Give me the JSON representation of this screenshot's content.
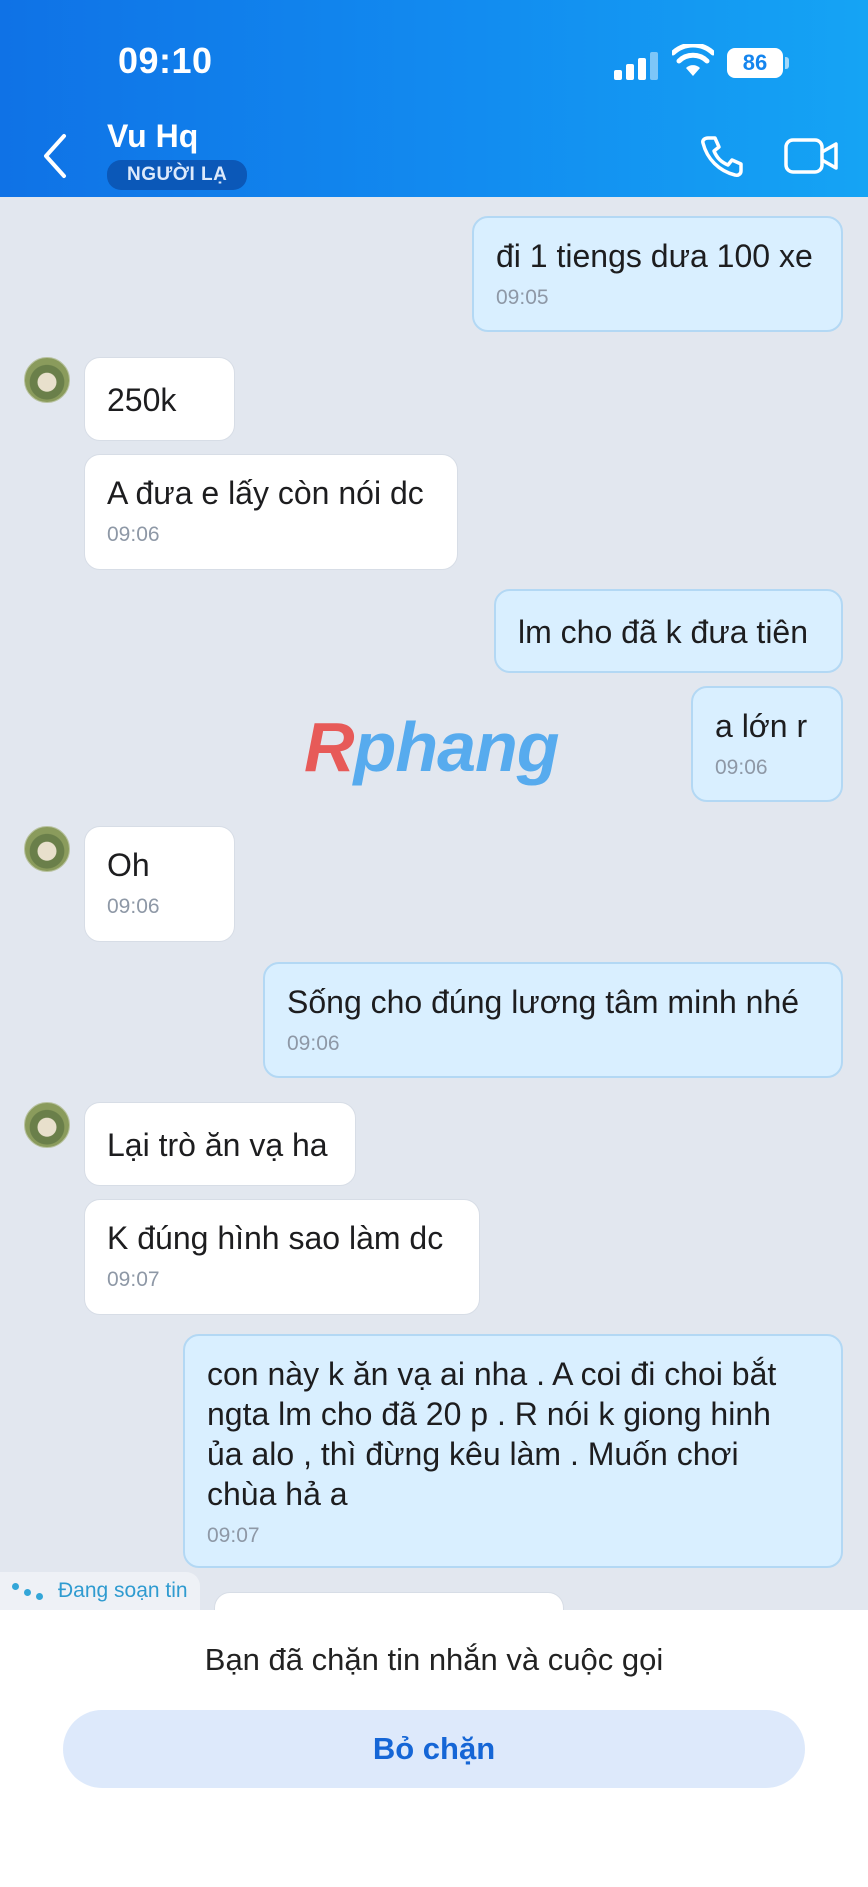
{
  "status_bar": {
    "time": "09:10",
    "battery": "86"
  },
  "header": {
    "contact_name": "Vu Hq",
    "badge": "NGƯỜI LẠ"
  },
  "messages": [
    {
      "direction": "out",
      "text": "đi 1 tiengs dưa 100 xe",
      "time": "09:05"
    },
    {
      "direction": "in",
      "text": "250k",
      "time": ""
    },
    {
      "direction": "in",
      "text": "A đưa e lấy còn nói dc",
      "time": "09:06"
    },
    {
      "direction": "out",
      "text": "lm cho đã k đưa tiên",
      "time": ""
    },
    {
      "direction": "out",
      "text": "a lớn r",
      "time": "09:06"
    },
    {
      "direction": "in",
      "text": "Oh",
      "time": "09:06"
    },
    {
      "direction": "out",
      "text": "Sống cho đúng lương tâm minh nhé",
      "time": "09:06"
    },
    {
      "direction": "in",
      "text": "Lại trò ăn vạ ha",
      "time": ""
    },
    {
      "direction": "in",
      "text": "K đúng hình sao làm dc",
      "time": "09:07"
    },
    {
      "direction": "out",
      "lines": [
        "con này k ăn vạ ai nha .   A coi đi choi bắt",
        "ngta lm cho đã 20 p . R nói k giong hinh",
        "ủa alo ,  thì đừng kêu làm . Muốn chơi",
        "chùa hả a"
      ],
      "time": "09:07"
    }
  ],
  "watermark": {
    "r": "R",
    "rest": "phang"
  },
  "typing_indicator": "Đang soạn tin",
  "blocked_notice": "Bạn đã chặn tin nhắn và cuộc gọi",
  "unblock_label": "Bỏ chặn",
  "colors": {
    "header_start": "#0f72e6",
    "header_end": "#15a4f4",
    "outgoing_bubble": "#d9efff",
    "incoming_bubble": "#ffffff",
    "chat_background": "#e2e7ef",
    "accent": "#1566d6"
  }
}
